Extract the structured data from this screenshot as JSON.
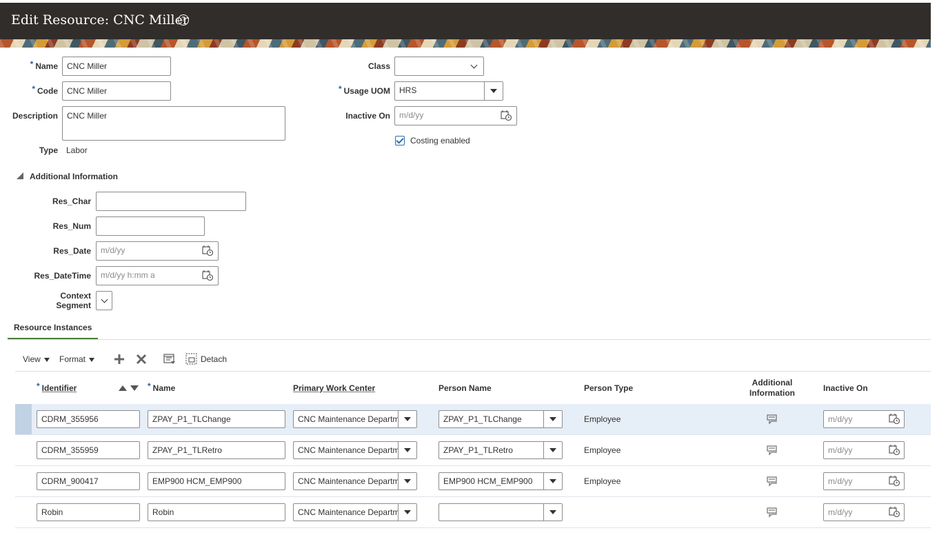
{
  "header": {
    "title": "Edit Resource: CNC Miller",
    "help_icon": "help-icon"
  },
  "form": {
    "name_label": "Name",
    "name_value": "CNC Miller",
    "code_label": "Code",
    "code_value": "CNC Miller",
    "description_label": "Description",
    "description_value": "CNC Miller",
    "type_label": "Type",
    "type_value": "Labor",
    "class_label": "Class",
    "class_value": "",
    "usage_uom_label": "Usage UOM",
    "usage_uom_value": "HRS",
    "inactive_on_label": "Inactive On",
    "inactive_on_placeholder": "m/d/yy",
    "costing_label": "Costing enabled",
    "costing_checked": true
  },
  "additional_info": {
    "title": "Additional Information",
    "res_char_label": "Res_Char",
    "res_char_value": "",
    "res_num_label": "Res_Num",
    "res_num_value": "",
    "res_date_label": "Res_Date",
    "res_date_placeholder": "m/d/yy",
    "res_datetime_label": "Res_DateTime",
    "res_datetime_placeholder": "m/d/yy h:mm a",
    "context_label_1": "Context",
    "context_label_2": "Segment"
  },
  "instances": {
    "tab_label": "Resource Instances",
    "toolbar": {
      "view": "View",
      "format": "Format",
      "detach": "Detach"
    },
    "columns": {
      "identifier": "Identifier",
      "name": "Name",
      "work_center": "Primary Work Center",
      "person_name": "Person Name",
      "person_type": "Person Type",
      "additional_1": "Additional",
      "additional_2": "Information",
      "inactive_on": "Inactive On"
    },
    "rows": [
      {
        "identifier": "CDRM_355956",
        "name": "ZPAY_P1_TLChange",
        "work_center": "CNC Maintenance Departm",
        "person_name": "ZPAY_P1_TLChange",
        "person_type": "Employee",
        "inactive_placeholder": "m/d/yy"
      },
      {
        "identifier": "CDRM_355959",
        "name": "ZPAY_P1_TLRetro",
        "work_center": "CNC Maintenance Departm",
        "person_name": "ZPAY_P1_TLRetro",
        "person_type": "Employee",
        "inactive_placeholder": "m/d/yy"
      },
      {
        "identifier": "CDRM_900417",
        "name": "EMP900 HCM_EMP900",
        "work_center": "CNC Maintenance Departm",
        "person_name": "EMP900 HCM_EMP900",
        "person_type": "Employee",
        "inactive_placeholder": "m/d/yy"
      },
      {
        "identifier": "Robin",
        "name": "Robin",
        "work_center": "CNC Maintenance Departm",
        "person_name": "",
        "person_type": "",
        "inactive_placeholder": "m/d/yy"
      }
    ]
  },
  "colors": {
    "header_bg": "#312d2a",
    "required": "#2f5f9e",
    "selected_row": "#e6eef8",
    "tab_accent": "#4b7d3a"
  }
}
